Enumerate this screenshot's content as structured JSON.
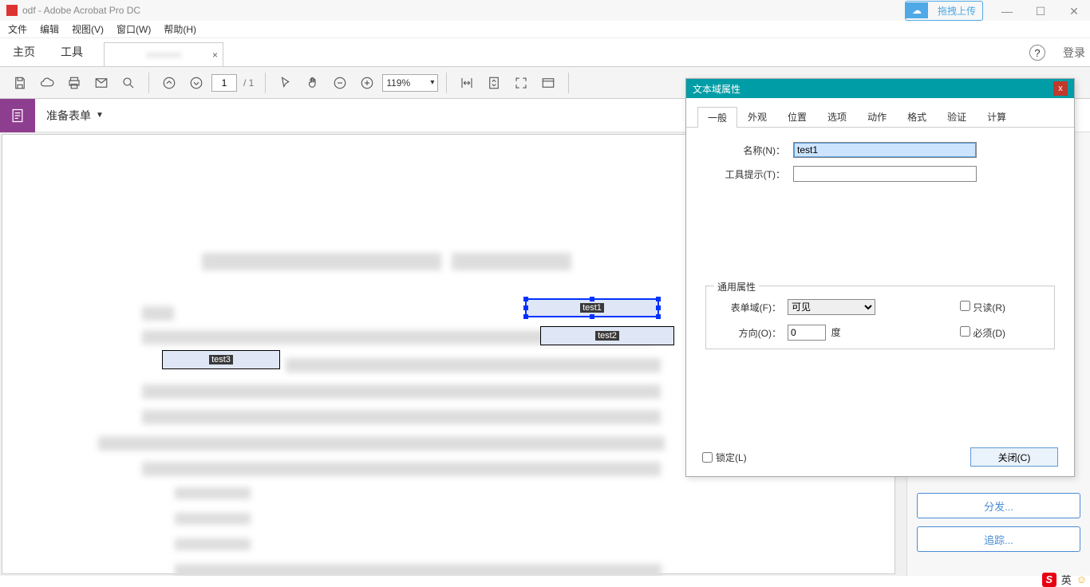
{
  "title_suffix": "odf - Adobe Acrobat Pro DC",
  "upload_text": "拖拽上传",
  "menus": [
    "文件",
    "编辑",
    "视图(V)",
    "窗口(W)",
    "帮助(H)"
  ],
  "tabs": {
    "home": "主页",
    "tools": "工具"
  },
  "login": "登录",
  "toolbar": {
    "page_current": "1",
    "page_total": "/ 1",
    "zoom": "119%"
  },
  "formbar": {
    "title": "准备表单"
  },
  "fields": [
    {
      "name": "test1",
      "selected": true
    },
    {
      "name": "test2",
      "selected": false
    },
    {
      "name": "test3",
      "selected": false
    }
  ],
  "dialog": {
    "title": "文本域属性",
    "tabs": [
      "一般",
      "外观",
      "位置",
      "选项",
      "动作",
      "格式",
      "验证",
      "计算"
    ],
    "active_tab": 0,
    "name_label": "名称(N)：",
    "name_value": "test1",
    "tooltip_label": "工具提示(T)：",
    "tooltip_value": "",
    "group_title": "通用属性",
    "form_field_label": "表单域(F)：",
    "form_field_value": "可见",
    "orientation_label": "方向(O)：",
    "orientation_value": "0",
    "orientation_unit": "度",
    "readonly_label": "只读(R)",
    "required_label": "必须(D)",
    "lock_label": "锁定(L)",
    "close_btn": "关闭(C)"
  },
  "rightpanel": {
    "distribute": "分发...",
    "track": "追踪..."
  },
  "ime": {
    "lang": "英"
  }
}
